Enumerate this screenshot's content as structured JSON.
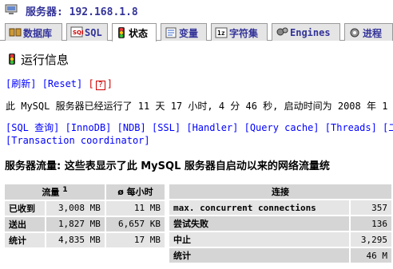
{
  "server": {
    "label": "服务器: 192.168.1.8"
  },
  "tabs": [
    {
      "label": "数据库",
      "icon": "database-icon"
    },
    {
      "label": "SQL",
      "icon": "sql-icon"
    },
    {
      "label": "状态",
      "icon": "traffic-light-icon",
      "active": true
    },
    {
      "label": "变量",
      "icon": "variables-icon"
    },
    {
      "label": "字符集",
      "icon": "charset-icon"
    },
    {
      "label": "Engines",
      "icon": "engines-icon"
    },
    {
      "label": "进程",
      "icon": "process-icon"
    }
  ],
  "heading": "运行信息",
  "actions": {
    "refresh": "[刷新]",
    "reset": "[Reset]",
    "help": "?"
  },
  "uptime": "此 MySQL 服务器已经运行了 11 天 17 小时, 4 分 46 秒, 启动时间为 2008 年 1",
  "sections": [
    "[SQL 查询]",
    "[InnoDB]",
    "[NDB]",
    "[SSL]",
    "[Handler]",
    "[Query cache]",
    "[Threads]",
    "[二进",
    "[Transaction coordinator]"
  ],
  "traffic": {
    "title": "服务器流量: 这些表显示了此 MySQL 服务器自启动以来的网络流量统",
    "headers": {
      "traffic": "流量",
      "traffic_sup": "1",
      "per_hour": "ø 每小时"
    },
    "rows": [
      {
        "label": "已收到",
        "value": "3,008 MB",
        "per_hour": "11 MB"
      },
      {
        "label": "送出",
        "value": "1,827 MB",
        "per_hour": "6,657 KB"
      },
      {
        "label": "统计",
        "value": "4,835 MB",
        "per_hour": "17 MB"
      }
    ]
  },
  "connections": {
    "header": "连接",
    "rows": [
      {
        "label": "max. concurrent connections",
        "value": "357"
      },
      {
        "label": "尝试失败",
        "value": "136"
      },
      {
        "label": "中止",
        "value": "3,295"
      },
      {
        "label": "统计",
        "value": "46 M"
      }
    ]
  },
  "colors": {
    "accent": "#333399",
    "link": "#0000ff",
    "header_bg": "#D5D5D5",
    "row_bg": "#E5E5E5"
  }
}
